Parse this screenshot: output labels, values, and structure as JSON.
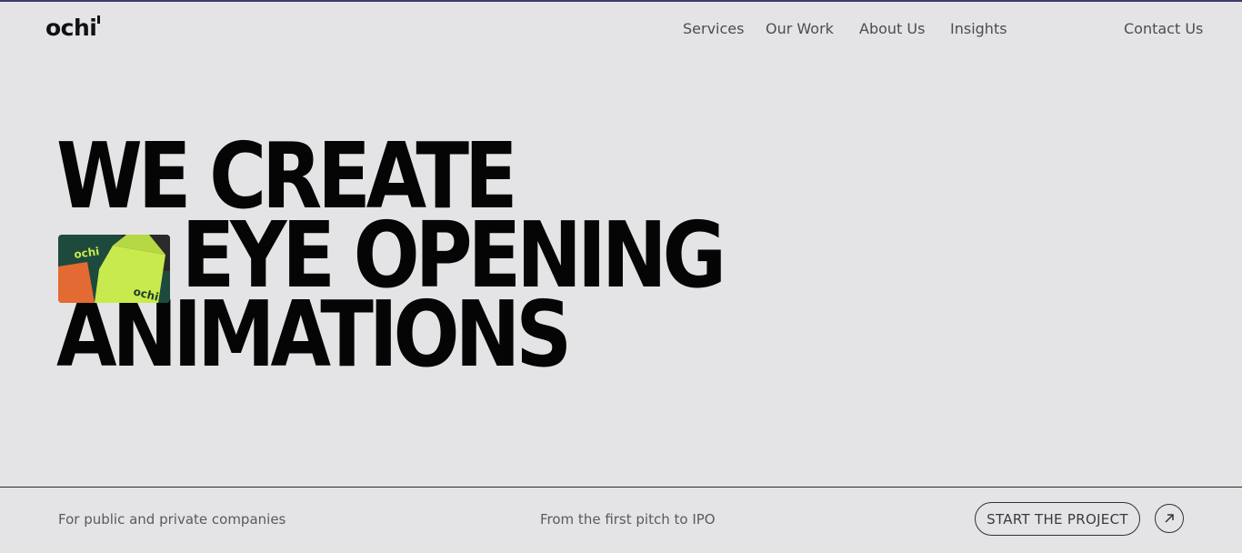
{
  "header": {
    "logo_text": "ochi",
    "nav": [
      {
        "label": "Services"
      },
      {
        "label": "Our Work"
      },
      {
        "label": "About Us"
      },
      {
        "label": "Insights"
      }
    ],
    "contact_label": "Contact Us"
  },
  "hero": {
    "line1": "WE CREATE",
    "line2": "EYE OPENING",
    "line3": "ANIMATIONS",
    "thumbnail": {
      "icon": "ochi-brand-cards-image",
      "card_text": "ochi",
      "colors": [
        "#1d4a3c",
        "#c8ea4c",
        "#e36a32",
        "#222222"
      ]
    }
  },
  "footer": {
    "tagline_left": "For public and private companies",
    "tagline_center": "From the first pitch to IPO",
    "cta_label": "START THE PROJECT",
    "arrow_icon": "arrow-up-right-icon"
  },
  "colors": {
    "background": "#e4e4e6",
    "accent_top": "#3b3b70",
    "text": "#050505"
  }
}
